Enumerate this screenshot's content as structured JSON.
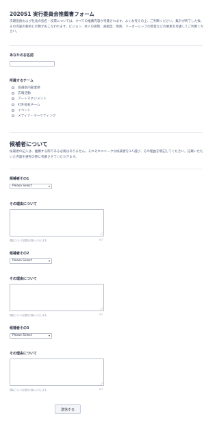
{
  "form": {
    "title": "2020S1 実行委員会推薦書フォーム",
    "description": "次期役員および社長の指名・投票については、すべての推薦内容が考慮されます。よくお考えの上、ご判断ください。集計が終了した後、その内容の要約と計算がおこなわれます。ビジョン、本人の姿勢、貢献度、情熱、リーダーシップの資質などの要素を考慮してご判断ください。"
  },
  "name_field": {
    "label": "あなたのお名前",
    "value": ""
  },
  "team_field": {
    "label": "所属するチーム",
    "options": [
      "協議会内部業務",
      "広報活動",
      "アートマネジメント",
      "社外福祉チーム",
      "イベント",
      "メディア・マーケティング"
    ]
  },
  "candidates_section": {
    "heading": "候補者について",
    "description": "候補者の記入は、推薦する際である必要はありません。それぞれユニークな候補者を3人選び、その理由を明記してください。記載いただいた内容を選考の際に考慮させていただきます。"
  },
  "candidates": [
    {
      "label": "候補者その1",
      "select_value": "Please Select",
      "reason_label": "その理由について",
      "reason_value": "",
      "hint": "理由について記載をお願いいたします。",
      "count": "0/7"
    },
    {
      "label": "候補者その2",
      "select_value": "Please Select",
      "reason_label": "その理由について",
      "reason_value": "",
      "hint": "理由について記載をお願いいたします。",
      "count": "0/7"
    },
    {
      "label": "候補者その3",
      "select_value": "Please Select",
      "reason_label": "その理由について",
      "reason_value": "",
      "hint": "理由について記載をお願いいたします。",
      "count": "0/7"
    }
  ],
  "submit_label": "送信する"
}
